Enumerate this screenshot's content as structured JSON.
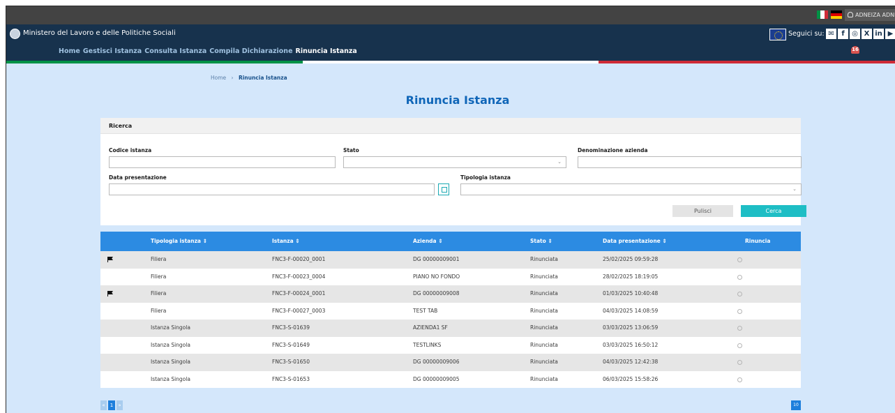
{
  "topbar": {
    "user_label": "ADNEIZA ADNEIZA",
    "flags": [
      "italian-flag-icon",
      "german-flag-icon"
    ]
  },
  "header": {
    "ministry_name": "Ministero del Lavoro e delle Politiche Sociali",
    "nav": [
      {
        "label": "Home",
        "active": false
      },
      {
        "label": "Gestisci Istanza",
        "active": false
      },
      {
        "label": "Consulta Istanza",
        "active": false
      },
      {
        "label": "Compila Dichiarazione",
        "active": false
      },
      {
        "label": "Rinuncia Istanza",
        "active": true
      }
    ],
    "follow_label": "Seguici su:",
    "social": [
      {
        "icon": "mail-icon",
        "glyph": "✉"
      },
      {
        "icon": "facebook-icon",
        "glyph": "f"
      },
      {
        "icon": "instagram-icon",
        "glyph": "◎"
      },
      {
        "icon": "x-icon",
        "glyph": "X"
      },
      {
        "icon": "linkedin-icon",
        "glyph": "in"
      },
      {
        "icon": "youtube-icon",
        "glyph": "▶"
      },
      {
        "icon": "rss-icon",
        "glyph": "≋"
      }
    ],
    "notifications_count": "16"
  },
  "colors": {
    "header_bg": "#17324d",
    "page_bg": "#d4e7fb",
    "table_head": "#2c8be2",
    "accent": "#1ebec5",
    "title": "#1066b8",
    "tricolor": [
      "#009246",
      "#ffffff",
      "#ce2b37"
    ]
  },
  "breadcrumb": {
    "home": "Home",
    "separator": "›",
    "current": "Rinuncia Istanza"
  },
  "page_title": "Rinuncia Istanza",
  "search": {
    "heading": "Ricerca",
    "fields": {
      "codice_label": "Codice istanza",
      "codice_value": "",
      "stato_label": "Stato",
      "stato_value": "",
      "azienda_label": "Denominazione azienda",
      "azienda_value": "",
      "data_label": "Data presentazione",
      "data_value": "",
      "tipologia_label": "Tipologia istanza",
      "tipologia_value": ""
    },
    "clear_label": "Pulisci",
    "search_label": "Cerca"
  },
  "table": {
    "columns": [
      "Tipologia istanza ⇕",
      "Istanza ⇕",
      "Azienda ⇕",
      "Stato ⇕",
      "Data presentazione ⇕",
      "Rinuncia"
    ],
    "rows": [
      {
        "flagged": true,
        "tipologia": "Filiera",
        "istanza": "FNC3-F-00020_0001",
        "azienda": "DG 00000009001",
        "stato": "Rinunciata",
        "data": "25/02/2025 09:59:28"
      },
      {
        "flagged": false,
        "tipologia": "Filiera",
        "istanza": "FNC3-F-00023_0004",
        "azienda": "PIANO NO FONDO",
        "stato": "Rinunciata",
        "data": "28/02/2025 18:19:05"
      },
      {
        "flagged": true,
        "tipologia": "Filiera",
        "istanza": "FNC3-F-00024_0001",
        "azienda": "DG 00000009008",
        "stato": "Rinunciata",
        "data": "01/03/2025 10:40:48"
      },
      {
        "flagged": false,
        "tipologia": "Filiera",
        "istanza": "FNC3-F-00027_0003",
        "azienda": "TEST TAB",
        "stato": "Rinunciata",
        "data": "04/03/2025 14:08:59"
      },
      {
        "flagged": false,
        "tipologia": "Istanza Singola",
        "istanza": "FNC3-S-01639",
        "azienda": "AZIENDA1 SF",
        "stato": "Rinunciata",
        "data": "03/03/2025 13:06:59"
      },
      {
        "flagged": false,
        "tipologia": "Istanza Singola",
        "istanza": "FNC3-S-01649",
        "azienda": "TESTLINKS",
        "stato": "Rinunciata",
        "data": "03/03/2025 16:50:12"
      },
      {
        "flagged": false,
        "tipologia": "Istanza Singola",
        "istanza": "FNC3-S-01650",
        "azienda": "DG 00000009006",
        "stato": "Rinunciata",
        "data": "04/03/2025 12:42:38"
      },
      {
        "flagged": false,
        "tipologia": "Istanza Singola",
        "istanza": "FNC3-S-01653",
        "azienda": "DG 00000009005",
        "stato": "Rinunciata",
        "data": "06/03/2025 15:58:26"
      }
    ]
  },
  "pagination": {
    "prev": "«",
    "current": "1",
    "next": "»",
    "page_size": "10"
  }
}
